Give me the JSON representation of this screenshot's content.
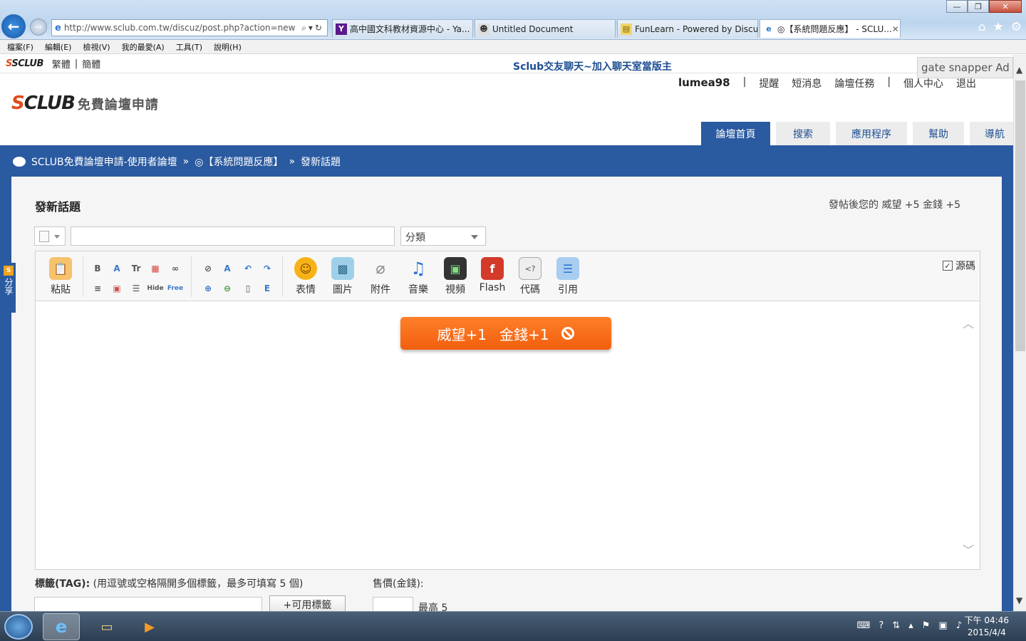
{
  "browser": {
    "address": "http://www.sclub.com.tw/discuz/post.php?action=new",
    "tabs": [
      {
        "title": "高中國文科教材資源中心 - Ya...",
        "icon": "yahoo-icon"
      },
      {
        "title": "Untitled Document",
        "icon": "page-icon"
      },
      {
        "title": "FunLearn - Powered by Discuz!",
        "icon": "funlearn-icon"
      },
      {
        "title": "◎【系統問題反應】 - SCLU...",
        "icon": "ie-icon"
      }
    ],
    "menu": [
      "檔案(F)",
      "編輯(E)",
      "檢視(V)",
      "我的最愛(A)",
      "工具(T)",
      "說明(H)"
    ]
  },
  "topstrip": {
    "logo": "SCLUB",
    "trad": "繁體",
    "simp": "簡體",
    "announce": "Sclub交友聊天~加入聊天室當版主",
    "ad": "gate snapper Ad"
  },
  "site": {
    "logo_main": "SCLUB",
    "logo_sub": "免費論壇申請"
  },
  "userbar": {
    "username": "lumea98",
    "links": [
      "提醒",
      "短消息",
      "論壇任務",
      "個人中心",
      "退出"
    ]
  },
  "navtabs": [
    "論壇首頁",
    "搜索",
    "應用程序",
    "幫助",
    "導航"
  ],
  "breadcrumb": [
    "SCLUB免費論壇申請-使用者論壇",
    "»",
    "◎【系統問題反應】",
    "»",
    "發新話題"
  ],
  "form": {
    "title": "發新話題",
    "reward": "發帖後您的 威望 +5   金錢 +5",
    "category": "分類",
    "subject_value": ""
  },
  "toolbar": {
    "paste": "粘貼",
    "emoticon": "表情",
    "image": "圖片",
    "attach": "附件",
    "music": "音樂",
    "video": "視頻",
    "flash": "Flash",
    "code": "代碼",
    "quote": "引用",
    "source": "源碼",
    "source_checked": true
  },
  "toast": {
    "prestige": "威望+1",
    "money": "金錢+1"
  },
  "tags": {
    "label": "標籤(TAG):",
    "hint": "(用逗號或空格隔開多個標籤，最多可填寫 5 個)",
    "button": "+可用標籤"
  },
  "price": {
    "label": "售價(金錢):",
    "max": "最高 5"
  },
  "share": "分享",
  "clock": {
    "time": "下午 04:46",
    "date": "2015/4/4"
  }
}
